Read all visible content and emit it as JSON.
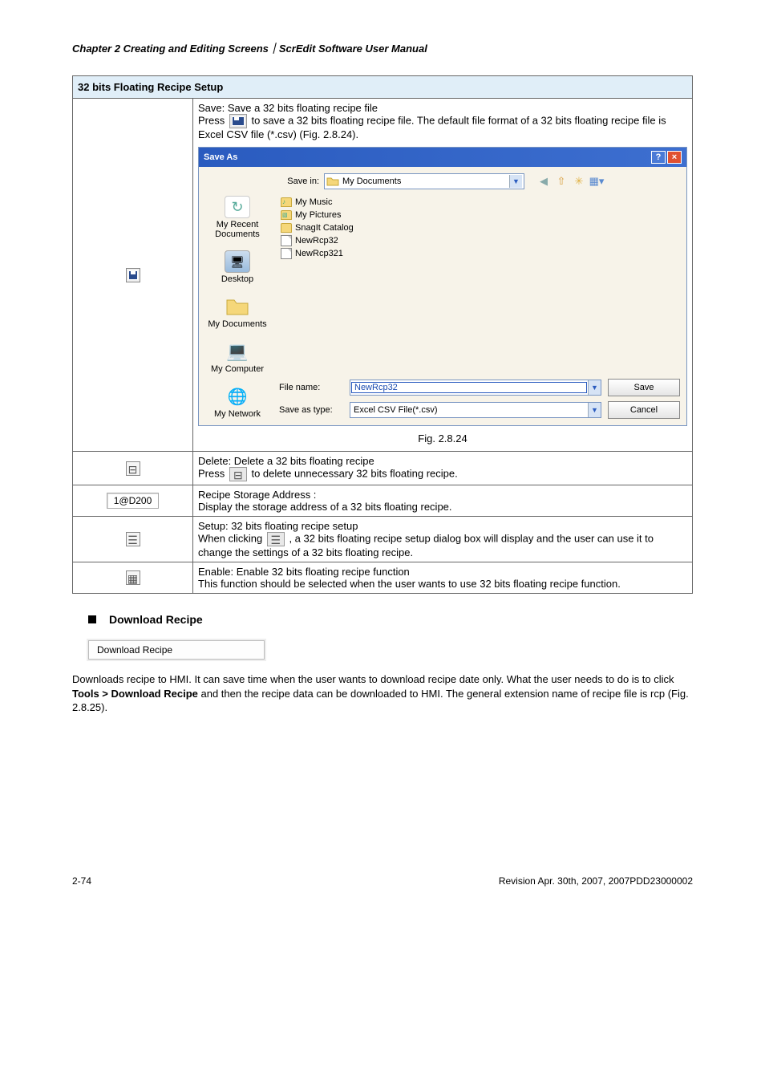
{
  "header": "Chapter 2  Creating and Editing Screens｜ScrEdit Software User Manual",
  "table": {
    "title": "32 bits Floating Recipe Setup",
    "rows": {
      "save": {
        "l1": "Save: Save a 32 bits floating recipe file",
        "press": "Press ",
        "l2": " to save a 32 bits floating recipe file. The default file format of a 32 bits floating recipe file is Excel CSV file (*.csv) (Fig. 2.8.24).",
        "figcap": "Fig. 2.8.24"
      },
      "delete": {
        "l1": "Delete: Delete a 32 bits floating recipe",
        "press": "Press ",
        "l2": " to delete unnecessary 32 bits floating recipe."
      },
      "storage": {
        "input": "1@D200",
        "l1": "Recipe Storage Address :",
        "l2": "Display the storage address of a 32 bits floating recipe."
      },
      "setup": {
        "l1": "Setup: 32 bits floating recipe setup",
        "l2a": "When clicking ",
        "l2b": ", a 32 bits floating recipe setup dialog box will display and the user can use it to change the settings of a 32 bits floating recipe."
      },
      "enable": {
        "l1": "Enable: Enable 32 bits floating recipe function",
        "l2": "This function should be selected when the user wants to use 32 bits floating recipe function."
      }
    }
  },
  "saveas": {
    "title": "Save As",
    "savein_label": "Save in:",
    "savein_value": "My Documents",
    "left": {
      "recent": "My Recent Documents",
      "desktop": "Desktop",
      "mydocs": "My Documents",
      "mycomp": "My Computer",
      "mynet": "My Network"
    },
    "files": {
      "f1": "My Music",
      "f2": "My Pictures",
      "f3": "SnagIt Catalog",
      "f4": "NewRcp32",
      "f5": "NewRcp321"
    },
    "filename_label": "File name:",
    "filename_value": "NewRcp32",
    "savetype_label": "Save as type:",
    "savetype_value": "Excel CSV File(*.csv)",
    "save_btn": "Save",
    "cancel_btn": "Cancel"
  },
  "section": {
    "title": "Download Recipe",
    "menu": "Download Recipe",
    "p1a": "Downloads recipe to HMI. It can save time when the user wants to download recipe date only. What the user needs to do is to click ",
    "p1b": "Tools > Download Recipe",
    "p1c": " and then the recipe data can be downloaded to HMI. The general extension name of recipe file is rcp (Fig. 2.8.25)."
  },
  "footer": {
    "page": "2-74",
    "rev": "Revision Apr. 30th, 2007, 2007PDD23000002"
  }
}
